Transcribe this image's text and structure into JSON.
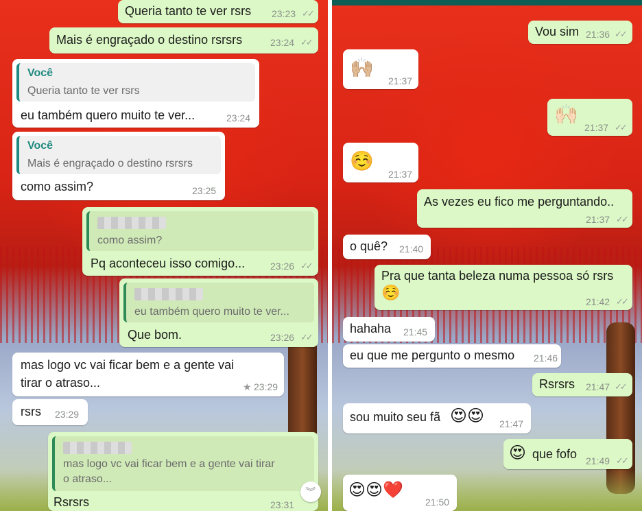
{
  "left": {
    "messages": [
      {
        "text": "Queria tanto te ver rsrs",
        "time": "23:23"
      },
      {
        "text": "Mais é engraçado o destino rsrsrs",
        "time": "23:24"
      },
      {
        "reply_name": "Você",
        "reply_text": "Queria tanto te ver rsrs",
        "text": "eu também quero muito te ver...",
        "time": "23:24"
      },
      {
        "reply_name": "Você",
        "reply_text": "Mais é engraçado o destino rsrsrs",
        "text": "como assim?",
        "time": "23:25"
      },
      {
        "reply_text": "como assim?",
        "text": "Pq aconteceu isso comigo...",
        "time": "23:26"
      },
      {
        "reply_text": "eu também quero muito te ver...",
        "text": "Que bom.",
        "time": "23:26"
      },
      {
        "text_line1": "mas logo vc vai ficar bem e a gente vai",
        "text_line2": "tirar o atraso...",
        "time": "23:29",
        "star": "★"
      },
      {
        "text": "rsrs",
        "time": "23:29"
      },
      {
        "reply_text_line1": "mas logo vc vai ficar bem e a gente vai tirar",
        "reply_text_line2": "o atraso...",
        "text": "Rsrsrs",
        "time": "23:31"
      }
    ],
    "scroll_icon": "︾"
  },
  "right": {
    "messages": [
      {
        "text": "Vou sim",
        "time": "21:36"
      },
      {
        "emoji": "🙌🏼",
        "time": "21:37"
      },
      {
        "emoji": "🙌🏻",
        "time": "21:37"
      },
      {
        "emoji": "☺️",
        "time": "21:37"
      },
      {
        "text": "As vezes eu fico me perguntando..",
        "time": "21:37"
      },
      {
        "text": "o quê?",
        "time": "21:40"
      },
      {
        "text": "Pra que tanta beleza numa pessoa só rsrs",
        "emoji": "☺️",
        "time": "21:42"
      },
      {
        "text": "hahaha",
        "time": "21:45"
      },
      {
        "text": "eu que me pergunto o mesmo",
        "time": "21:46"
      },
      {
        "text": "Rsrsrs",
        "time": "21:47"
      },
      {
        "text": "sou muito seu fã",
        "emoji": "😍😍",
        "time": "21:47"
      },
      {
        "emoji": "😍",
        "text": "que fofo",
        "time": "21:49"
      },
      {
        "emoji": "😍😍❤️",
        "time": "21:50"
      }
    ]
  },
  "colors": {
    "outgoing": "#dcf8c6",
    "incoming": "#ffffff",
    "quote_name": "#1f8a80",
    "header": "#0e5e55"
  },
  "icons": {
    "read_ticks": "double-check-icon",
    "star": "star-icon",
    "scroll": "scroll-down-icon"
  }
}
